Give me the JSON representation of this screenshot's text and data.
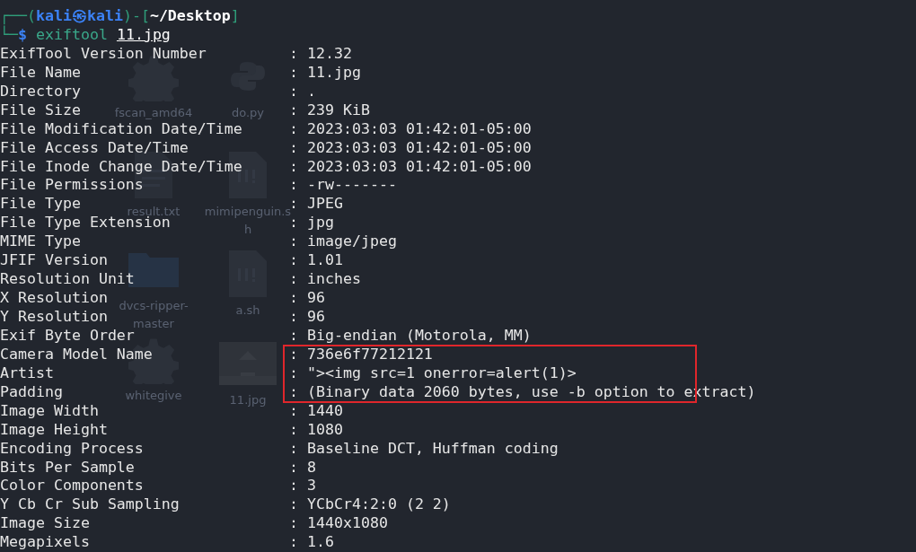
{
  "desktop_icons": [
    {
      "label": "fscan_amd64",
      "kind": "gear"
    },
    {
      "label": "do.py",
      "kind": "python"
    },
    {
      "label": "result.txt",
      "kind": "document"
    },
    {
      "label": "mimipenguin.sh",
      "kind": "script"
    },
    {
      "label": "dvcs-ripper-master",
      "kind": "folder"
    },
    {
      "label": "a.sh",
      "kind": "script"
    },
    {
      "label": "whitegive",
      "kind": "gear"
    },
    {
      "label": "11.jpg",
      "kind": "image"
    }
  ],
  "prompt": {
    "open": "┌──(",
    "user": "kali",
    "symbol": "㉿",
    "host": "kali",
    "middle": ")-[",
    "path": "~/Desktop",
    "close": "]",
    "corner": "└─",
    "dollar": "$",
    "command": "exiftool",
    "argument": "11.jpg"
  },
  "rows": [
    {
      "tag": "ExifTool Version Number",
      "separator": ":",
      "value": "12.32",
      "highlighted": false
    },
    {
      "tag": "File Name",
      "value": "11.jpg",
      "highlighted": false
    },
    {
      "tag": "Directory",
      "value": ".",
      "highlighted": false
    },
    {
      "tag": "File Size",
      "value": "239 KiB",
      "highlighted": false
    },
    {
      "tag": "File Modification Date/Time",
      "value": "2023:03:03 01:42:01-05:00",
      "highlighted": false
    },
    {
      "tag": "File Access Date/Time",
      "value": "2023:03:03 01:42:01-05:00",
      "highlighted": false
    },
    {
      "tag": "File Inode Change Date/Time",
      "value": "2023:03:03 01:42:01-05:00",
      "highlighted": false
    },
    {
      "tag": "File Permissions",
      "value": "-rw-------",
      "highlighted": false
    },
    {
      "tag": "File Type",
      "value": "JPEG",
      "highlighted": false
    },
    {
      "tag": "File Type Extension",
      "value": "jpg",
      "highlighted": false
    },
    {
      "tag": "MIME Type",
      "value": "image/jpeg",
      "highlighted": false
    },
    {
      "tag": "JFIF Version",
      "value": "1.01",
      "highlighted": false
    },
    {
      "tag": "Resolution Unit",
      "value": "inches",
      "highlighted": false
    },
    {
      "tag": "X Resolution",
      "value": "96",
      "highlighted": false
    },
    {
      "tag": "Y Resolution",
      "value": "96",
      "highlighted": false
    },
    {
      "tag": "Exif Byte Order",
      "value": "Big-endian (Motorola, MM)",
      "highlighted": false
    },
    {
      "tag": "Camera Model Name",
      "value": "736e6f77212121",
      "highlighted": true
    },
    {
      "tag": "Artist",
      "value": "\"><img src=1 onerror=alert(1)>",
      "highlighted": true
    },
    {
      "tag": "Padding",
      "value": "(Binary data 2060 bytes, use -b option to extract)",
      "highlighted": true
    },
    {
      "tag": "Image Width",
      "value": "1440",
      "highlighted": false
    },
    {
      "tag": "Image Height",
      "value": "1080",
      "highlighted": false
    },
    {
      "tag": "Encoding Process",
      "value": "Baseline DCT, Huffman coding",
      "highlighted": false
    },
    {
      "tag": "Bits Per Sample",
      "value": "8",
      "highlighted": false
    },
    {
      "tag": "Color Components",
      "value": "3",
      "highlighted": false
    },
    {
      "tag": "Y Cb Cr Sub Sampling",
      "value": "YCbCr4:2:0 (2 2)",
      "highlighted": false
    },
    {
      "tag": "Image Size",
      "value": "1440x1080",
      "highlighted": false
    },
    {
      "tag": "Megapixels",
      "value": "1.6",
      "highlighted": false
    }
  ]
}
